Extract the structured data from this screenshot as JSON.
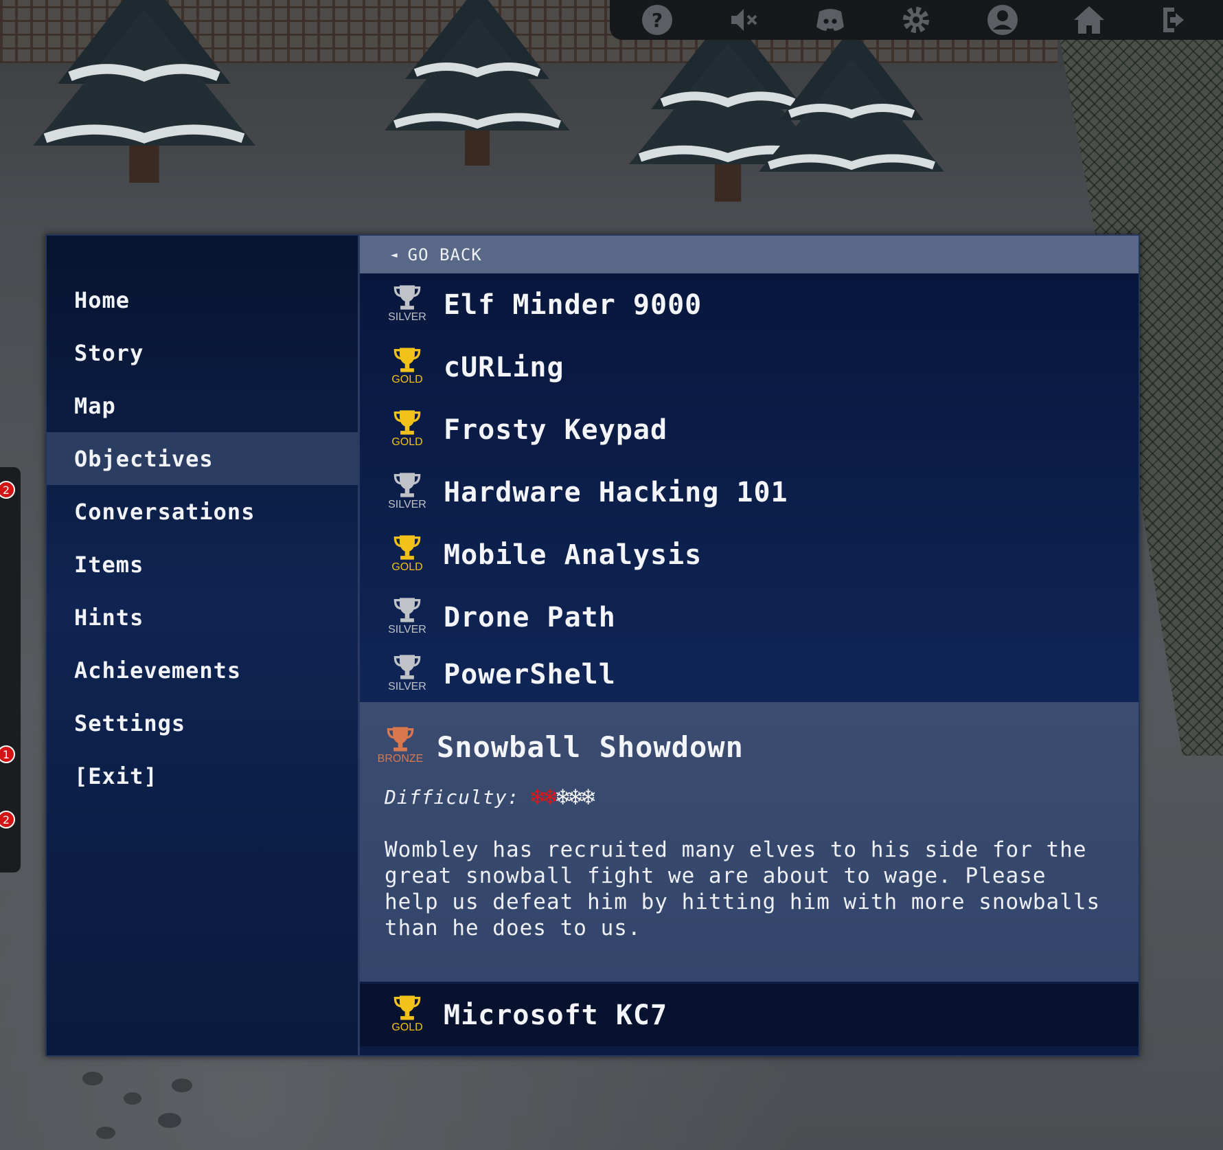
{
  "toolbar": {
    "icons": [
      "help-icon",
      "mute-icon",
      "discord-icon",
      "settings-icon",
      "account-icon",
      "home-icon",
      "logout-icon"
    ]
  },
  "side_badges": [
    "2",
    "1",
    "2"
  ],
  "nav": {
    "items": [
      {
        "label": "Home"
      },
      {
        "label": "Story"
      },
      {
        "label": "Map"
      },
      {
        "label": "Objectives"
      },
      {
        "label": "Conversations"
      },
      {
        "label": "Items"
      },
      {
        "label": "Hints"
      },
      {
        "label": "Achievements"
      },
      {
        "label": "Settings"
      },
      {
        "label": "[Exit]"
      }
    ],
    "active": "Objectives"
  },
  "content": {
    "go_back": "GO BACK",
    "go_back_arrow": "◄",
    "objectives": [
      {
        "title": "Elf Minder 9000",
        "tier": "SILVER",
        "color": "#bfc3c8"
      },
      {
        "title": "cURLing",
        "tier": "GOLD",
        "color": "#f2c21a"
      },
      {
        "title": "Frosty Keypad",
        "tier": "GOLD",
        "color": "#f2c21a"
      },
      {
        "title": "Hardware Hacking 101",
        "tier": "SILVER",
        "color": "#bfc3c8"
      },
      {
        "title": "Mobile Analysis",
        "tier": "GOLD",
        "color": "#f2c21a"
      },
      {
        "title": "Drone Path",
        "tier": "SILVER",
        "color": "#bfc3c8"
      },
      {
        "title": "PowerShell",
        "tier": "SILVER",
        "color": "#bfc3c8"
      }
    ],
    "expanded": {
      "title": "Snowball Showdown",
      "tier": "BRONZE",
      "color": "#d9774f",
      "difficulty_label": "Difficulty:",
      "difficulty_level": 2,
      "difficulty_max": 5,
      "flake": "❄",
      "description": "Wombley has recruited many elves to his side for the great snowball fight we are about to wage. Please help us defeat him by hitting him with more snowballs than he does to us."
    },
    "last": {
      "title": "Microsoft KC7",
      "tier": "GOLD",
      "color": "#f2c21a"
    }
  }
}
